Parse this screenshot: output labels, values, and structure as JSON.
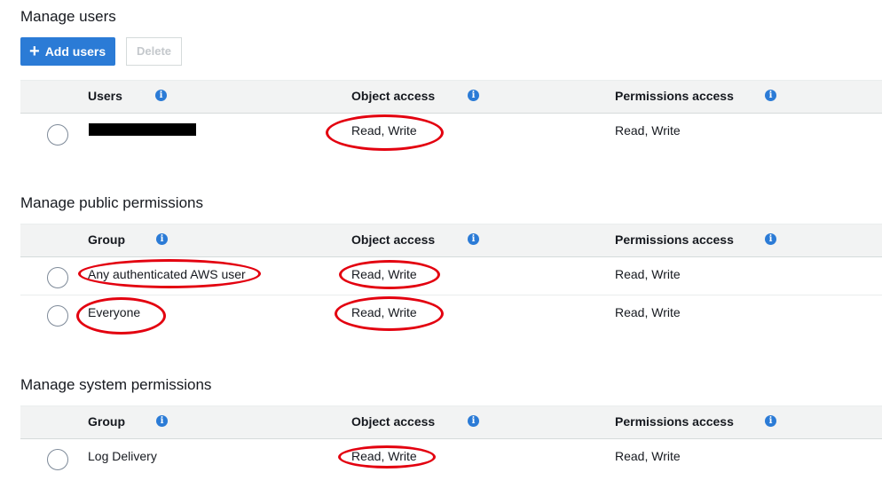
{
  "manage_users": {
    "title": "Manage users",
    "add_button": "Add users",
    "delete_button": "Delete",
    "headers": {
      "col1": "Users",
      "col2": "Object access",
      "col3": "Permissions access"
    },
    "rows": [
      {
        "name": "",
        "object_access": "Read, Write",
        "permissions_access": "Read, Write",
        "redacted": true
      }
    ]
  },
  "public_permissions": {
    "title": "Manage public permissions",
    "headers": {
      "col1": "Group",
      "col2": "Object access",
      "col3": "Permissions access"
    },
    "rows": [
      {
        "name": "Any authenticated AWS user",
        "object_access": "Read, Write",
        "permissions_access": "Read, Write"
      },
      {
        "name": "Everyone",
        "object_access": "Read, Write",
        "permissions_access": "Read, Write"
      }
    ]
  },
  "system_permissions": {
    "title": "Manage system permissions",
    "headers": {
      "col1": "Group",
      "col2": "Object access",
      "col3": "Permissions access"
    },
    "rows": [
      {
        "name": "Log Delivery",
        "object_access": "Read, Write",
        "permissions_access": "Read, Write"
      }
    ]
  },
  "info_icon": "info-icon",
  "annotation_color": "#e3000f",
  "accent_color": "#2b7bd6"
}
